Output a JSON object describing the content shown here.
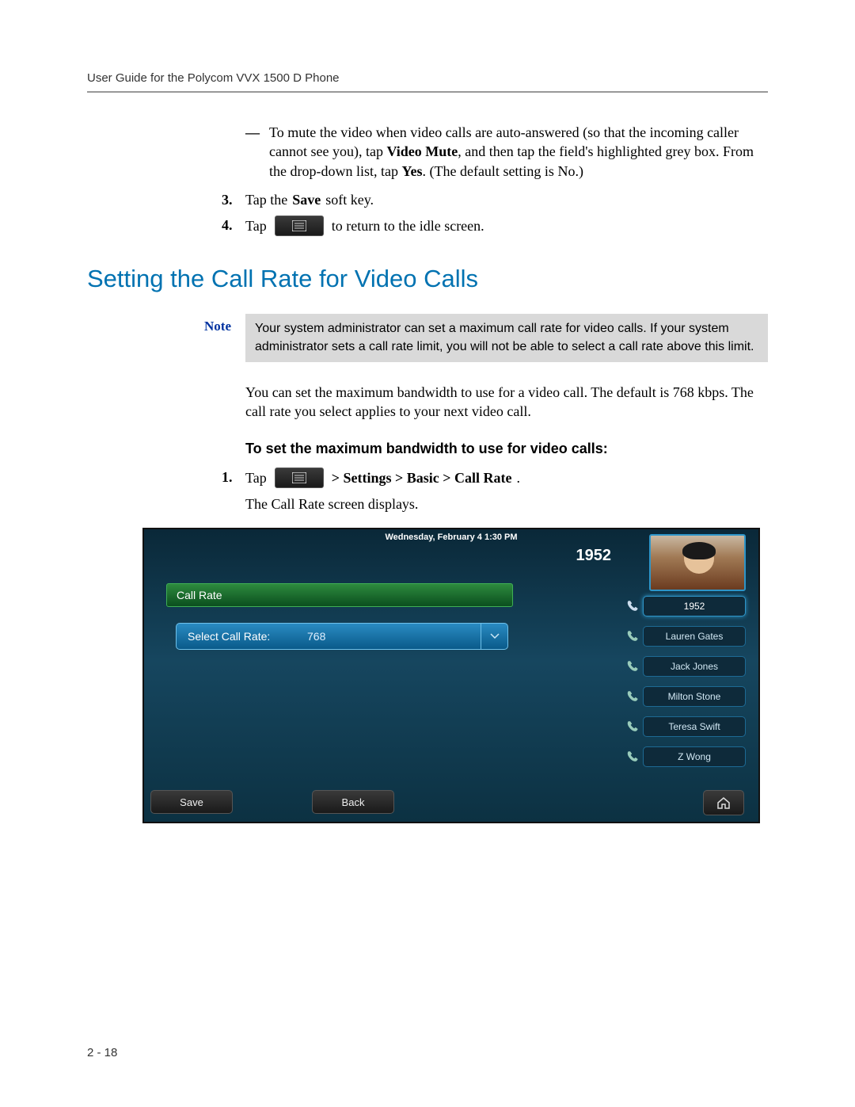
{
  "header": "User Guide for the Polycom VVX 1500 D Phone",
  "bullet": {
    "pre": "To mute the video when video calls are auto-answered (so that the incoming caller cannot see you), tap ",
    "b1": "Video Mute",
    "mid": ", and then tap the field's highlighted grey box. From the drop-down list, tap ",
    "b2": "Yes",
    "post": ". (The default setting is No.)"
  },
  "step3": {
    "num": "3.",
    "pre": "Tap the ",
    "bold": "Save",
    "post": " soft key."
  },
  "step4": {
    "num": "4.",
    "pre": "Tap",
    "post": "to return to the idle screen."
  },
  "heading": "Setting the Call Rate for Video Calls",
  "note": {
    "label": "Note",
    "text": "Your system administrator can set a maximum call rate for video calls. If your system administrator sets a call rate limit, you will not be able to select a call rate above this limit."
  },
  "para": "You can set the maximum bandwidth to use for a video call. The default is 768 kbps. The call rate you select applies to your next video call.",
  "subhead": "To set the maximum bandwidth to use for video calls:",
  "step1b": {
    "num": "1.",
    "pre": "Tap",
    "path": " > Settings > Basic > Call Rate",
    "post": ".",
    "line2": "The Call Rate screen displays."
  },
  "screenshot": {
    "date": "Wednesday, February 4  1:30 PM",
    "ext": "1952",
    "title": "Call Rate",
    "field_label": "Select Call Rate:",
    "field_value": "768",
    "contacts": [
      "1952",
      "Lauren Gates",
      "Jack Jones",
      "Milton Stone",
      "Teresa Swift",
      "Z Wong"
    ],
    "softkeys": {
      "save": "Save",
      "back": "Back"
    }
  },
  "pagenum": "2 - 18"
}
